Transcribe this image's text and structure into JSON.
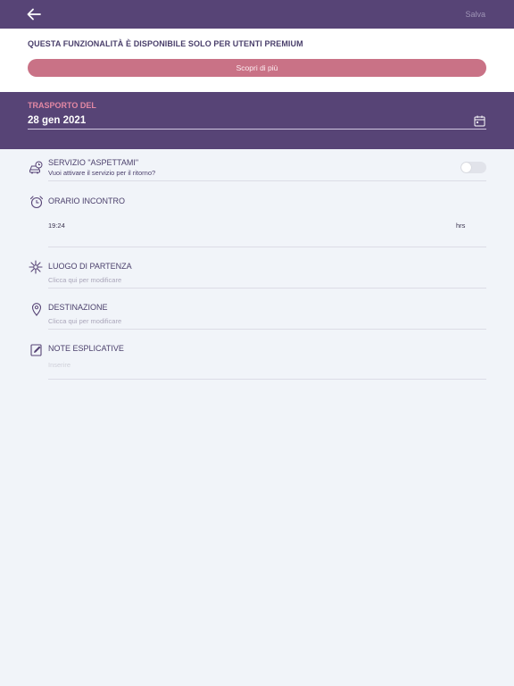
{
  "header": {
    "back_icon": "arrow-left-icon",
    "save_label": "Salva"
  },
  "premium": {
    "message": "QUESTA FUNZIONALITÀ È DISPONIBILE SOLO PER UTENTI PREMIUM",
    "button_label": "Scopri di più",
    "button_color": "#c97286"
  },
  "transport": {
    "label": "TRASPORTO DEL",
    "date": "28 gen 2021",
    "calendar_icon": "calendar-icon"
  },
  "wait_service": {
    "icon": "car-clock-icon",
    "title": "SERVIZIO \"ASPETTAMI\"",
    "subtitle": "Vuoi attivare il servizio per il ritorno?",
    "enabled": false
  },
  "meeting_time": {
    "icon": "alarm-clock-icon",
    "title": "ORARIO INCONTRO",
    "value": "19:24",
    "unit": "hrs"
  },
  "departure": {
    "icon": "starburst-icon",
    "title": "LUOGO DI PARTENZA",
    "placeholder": "Clicca qui per modificare"
  },
  "destination": {
    "icon": "location-pin-icon",
    "title": "DESTINAZIONE",
    "placeholder": "Clicca qui per modificare"
  },
  "notes": {
    "icon": "edit-note-icon",
    "title": "NOTE ESPLICATIVE",
    "placeholder": "Inserire"
  },
  "colors": {
    "primary": "#574476",
    "accent_pink": "#e388a4",
    "background": "#f1f4f9"
  }
}
